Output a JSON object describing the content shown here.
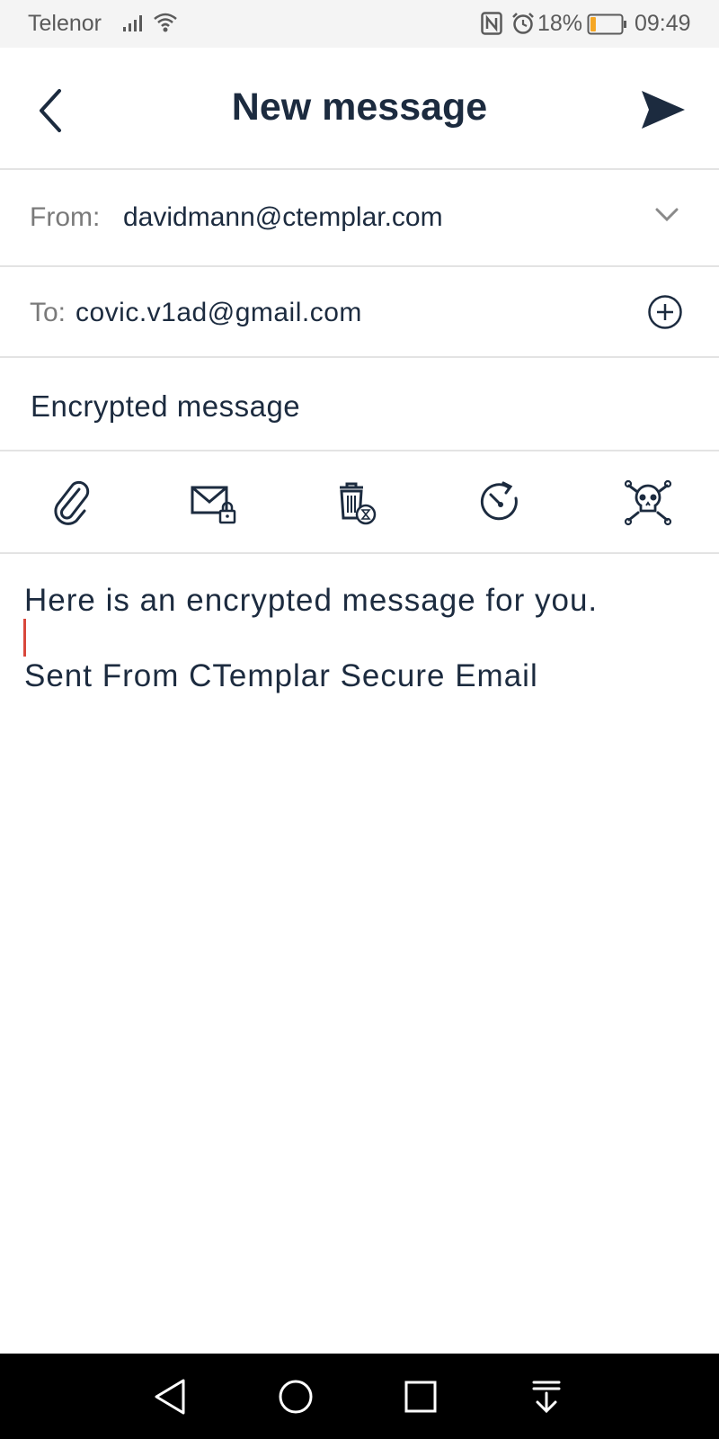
{
  "status_bar": {
    "carrier": "Telenor",
    "battery_percent": "18%",
    "time": "09:49",
    "battery_level": 0.18,
    "battery_color": "#f5a623",
    "icons": [
      "signal-icon",
      "wifi-icon",
      "nfc-icon",
      "alarm-icon",
      "battery-icon"
    ]
  },
  "header": {
    "title": "New message",
    "back_icon": "chevron-left-icon",
    "send_icon": "send-icon"
  },
  "compose": {
    "from_label": "From:",
    "from_value": "davidmann@ctemplar.com",
    "to_label": "To:",
    "to_value": "covic.v1ad@gmail.com",
    "subject": "Encrypted message"
  },
  "toolbar": {
    "tools": [
      {
        "icon": "paperclip-icon"
      },
      {
        "icon": "encrypted-mail-icon"
      },
      {
        "icon": "delete-timer-icon"
      },
      {
        "icon": "delayed-delivery-icon"
      },
      {
        "icon": "dead-man-timer-icon"
      }
    ]
  },
  "body": {
    "line1": "Here is an encrypted message for you.",
    "signature": "Sent From CTemplar Secure Email"
  },
  "nav_bar": {
    "icons": [
      "back-triangle-icon",
      "home-circle-icon",
      "recents-square-icon",
      "notification-pull-icon"
    ]
  },
  "colors": {
    "text_primary": "#1c2b3f",
    "label_gray": "#7a7a7a",
    "cursor": "#d9483b",
    "divider": "#e3e3e3"
  }
}
